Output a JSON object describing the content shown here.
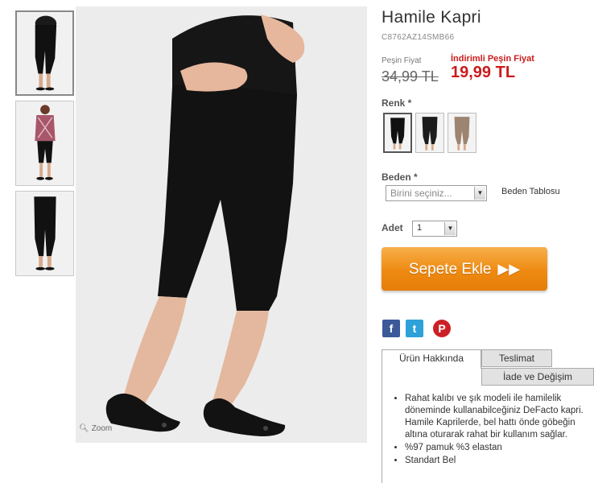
{
  "product": {
    "title": "Hamile Kapri",
    "code": "C8762AZ14SMB66"
  },
  "price": {
    "old_label": "Peşin Fiyat",
    "old_value": "34,99 TL",
    "new_label": "İndirimli Peşin Fiyat",
    "new_value": "19,99 TL",
    "accent_color": "#cc1b1b"
  },
  "gallery": {
    "zoom_label": "Zoom",
    "thumbnails": [
      "black-capri-front",
      "checked-shirt-capri",
      "black-capri-back"
    ]
  },
  "color": {
    "label": "Renk *",
    "options": [
      "black",
      "black-alt",
      "beige"
    ]
  },
  "size": {
    "label": "Beden *",
    "placeholder": "Birini seçiniz...",
    "chart_link": "Beden Tablosu"
  },
  "quantity": {
    "label": "Adet",
    "value": "1"
  },
  "cart": {
    "button_label": "Sepete Ekle",
    "button_icon": "double-arrow-icon",
    "color": "#ee8a12"
  },
  "share": {
    "facebook": "f",
    "twitter": "t",
    "pinterest": "P"
  },
  "tabs": {
    "about": "Ürün Hakkında",
    "delivery": "Teslimat",
    "returns": "İade ve Değişim"
  },
  "description": [
    "Rahat kalıbı ve şık modeli ile hamilelik döneminde kullanabilceğiniz DeFacto kapri. Hamile Kaprilerde, bel hattı önde göbeğin altına oturarak rahat bir kullanım sağlar.",
    "%97 pamuk %3 elastan",
    "Standart Bel"
  ]
}
